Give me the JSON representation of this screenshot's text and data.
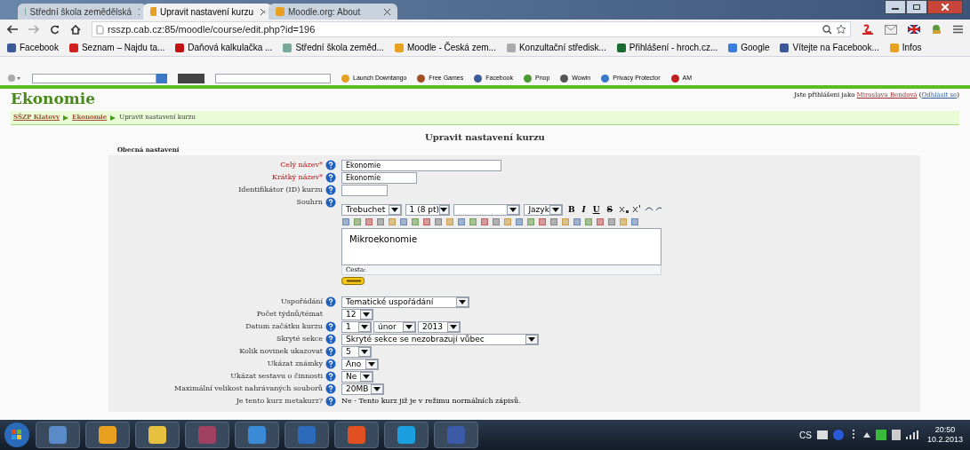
{
  "browser": {
    "tabs": [
      {
        "title": "Střední škola zemědělská",
        "selected": false
      },
      {
        "title": "Upravit nastavení kurzu",
        "selected": true
      },
      {
        "title": "Moodle.org: About",
        "selected": false
      }
    ],
    "address": "rsszp.cab.cz:85/moodle/course/edit.php?id=196",
    "bookmarks": [
      "Facebook",
      "Seznam – Najdu ta...",
      "Daňová kalkulačka ...",
      "Střední škola zeměd...",
      "Moodle - Česká zem...",
      "Konzultační středisk...",
      "Přihlášení - hroch.cz...",
      "Google",
      "Vítejte na Facebook...",
      "Infos"
    ],
    "toolbar_items": [
      "Launch Downtango",
      "Free Games",
      "Facebook",
      "Pnop",
      "Wowin",
      "Privacy Protector",
      "AM"
    ]
  },
  "page": {
    "site_title": "Ekonomie",
    "login": {
      "prefix": "Jste přihlášeni jako",
      "user": "Miroslava Bendová",
      "logout": "Odhlásit se",
      "brackets": [
        "(",
        ")"
      ]
    },
    "breadcrumb": [
      {
        "text": "SŠZP Klatovy",
        "link": true
      },
      {
        "text": "Ekonomie",
        "link": true
      },
      {
        "text": "Upravit nastavení kurzu",
        "link": false
      }
    ],
    "heading": "Upravit nastavení kurzu",
    "legend": "Obecná nastavení",
    "fields": [
      {
        "label": "Celý název*",
        "required": true,
        "help": true,
        "kind": "text",
        "value": "Ekonomie"
      },
      {
        "label": "Krátký název*",
        "required": true,
        "help": true,
        "kind": "text",
        "value": "Ekonomie"
      },
      {
        "label": "Identifikátor (ID) kurzu",
        "required": false,
        "help": true,
        "kind": "text"
      },
      {
        "label": "Souhrn",
        "required": false,
        "help": true,
        "kind": "editor"
      },
      {
        "label": "Uspořádání",
        "required": false,
        "help": true,
        "kind": "select",
        "options": [
          "Tematické uspořádání"
        ]
      },
      {
        "label": "Počet týdnů/témat",
        "required": false,
        "help": false,
        "kind": "select",
        "options": [
          "12"
        ]
      },
      {
        "label": "Datum začátku kurzu",
        "required": false,
        "help": true,
        "kind": "select",
        "options": [
          "1",
          "únor",
          "2013"
        ]
      },
      {
        "label": "Skryté sekce",
        "required": false,
        "help": true,
        "kind": "select",
        "options": [
          "Skryté sekce se nezobrazují vůbec"
        ]
      },
      {
        "label": "Kolik novinek ukazovat",
        "required": false,
        "help": true,
        "kind": "select",
        "options": [
          "5"
        ]
      },
      {
        "label": "Ukázat známky",
        "required": false,
        "help": true,
        "kind": "select",
        "options": [
          "Ano"
        ]
      },
      {
        "label": "Ukázat sestavu o činnosti",
        "required": false,
        "help": true,
        "kind": "select",
        "options": [
          "Ne"
        ]
      },
      {
        "label": "Maximální velikost nahrávaných souborů",
        "required": false,
        "help": true,
        "kind": "select",
        "options": [
          "20MB"
        ]
      },
      {
        "label": "Je tento kurz metakurz?",
        "required": false,
        "help": true,
        "kind": "static",
        "value": "Ne - Tento kurz již je v režimu normálních zápisů."
      }
    ],
    "editor": {
      "selects": [
        "Trebuchet",
        "1 (8 pt)",
        "Jazyk"
      ],
      "format_buttons": [
        "B",
        "I",
        "U",
        "S"
      ],
      "content": "Mikroekonomie",
      "path": "Cesta:"
    }
  },
  "taskbar": {
    "language": "CS",
    "time": "20:50",
    "date": "10.2.2013"
  }
}
